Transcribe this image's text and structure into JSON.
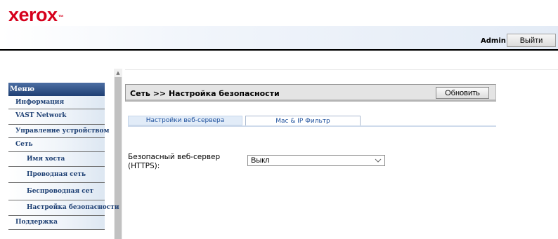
{
  "brand": {
    "logo": "xerox",
    "trademark": "™",
    "color": "#d6001c"
  },
  "header": {
    "user": "Admin",
    "logout_label": "Выйти"
  },
  "sidebar": {
    "title": "Меню",
    "items": [
      {
        "label": "Информация"
      },
      {
        "label": "VAST Network"
      },
      {
        "label": "Управление устройством"
      },
      {
        "label": "Сеть"
      },
      {
        "label": "Имя хоста"
      },
      {
        "label": "Проводная сеть"
      },
      {
        "label": "Беспроводная сет"
      },
      {
        "label": "Настройка безопасности"
      },
      {
        "label": "Поддержка"
      }
    ]
  },
  "main": {
    "title": "Сеть >> Настройка безопасности",
    "refresh_label": "Обновить",
    "tabs": [
      {
        "label": "Настройки веб-сервера",
        "active": true
      },
      {
        "label": "Mac & IP Фильтр",
        "active": false
      }
    ],
    "form": {
      "https_label_line1": "Безопасный веб-сервер",
      "https_label_line2": "(HTTPS):",
      "https_value": "Выкл"
    }
  },
  "icons": {
    "scroll_up": "caret-up-icon",
    "dropdown": "chevron-down-icon"
  }
}
